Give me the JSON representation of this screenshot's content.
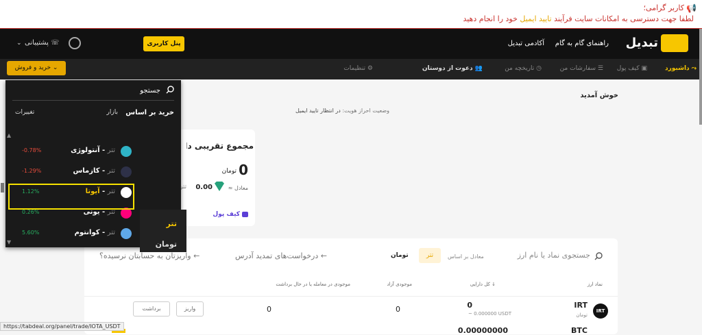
{
  "notice": {
    "greeting": "کاربر گرامی؛",
    "message_pre": "لطفا جهت دسترسی به امکانات سایت فرآیند ",
    "message_link": "تایید ایمیل",
    "message_post": " خود را انجام دهید"
  },
  "topbar": {
    "logo_text": "تبدیل",
    "guide": "راهنمای گام به گام",
    "academy": "آکادمی تبدیل",
    "panel_button": "پنل کاربری",
    "support": "پشتیبانی"
  },
  "nav": {
    "dashboard": "داشبورد",
    "wallet": "کیف پول",
    "orders": "سفارشات من",
    "history": "تاریخچه من",
    "invite": "دعوت از دوستان",
    "settings": "تنظیمات",
    "buy_sell": "خرید و فروش"
  },
  "welcome": "خوش آمدید",
  "kyc": {
    "label": "وضعیت احراز هویت:",
    "value": "در انتظار تایید ایمیل"
  },
  "dropdown": {
    "search_placeholder": "جستجو",
    "headers": {
      "sort": "خرید بر اساس",
      "market": "بازار",
      "changes": "تغییرات"
    },
    "coins": [
      {
        "name": "آنتولوژی",
        "quote": "تتر",
        "change": "-0.78%",
        "dir": "neg",
        "color": "#2fb3c6"
      },
      {
        "name": "کازماس",
        "quote": "تتر",
        "change": "-1.29%",
        "dir": "neg",
        "color": "#2e3148"
      },
      {
        "name": "آیوتا",
        "quote": "تتر",
        "change": "1.12%",
        "dir": "pos",
        "color": "#ffffff"
      },
      {
        "name": "یونی",
        "quote": "تتر",
        "change": "0.26%",
        "dir": "pos",
        "color": "#ff007a"
      },
      {
        "name": "کوانتوم",
        "quote": "تتر",
        "change": "5.60%",
        "dir": "pos",
        "color": "#5fa8e8"
      }
    ],
    "currencies": {
      "teter": "تتر",
      "toman": "تومان"
    }
  },
  "card": {
    "title": "مجموع تقریبی دارایی",
    "amount": "0",
    "unit": "تومان",
    "approx": "≈ معادل",
    "usdt_value": "0.00",
    "usdt_label": "تتر",
    "wallet_link": "کیف پول"
  },
  "assets": {
    "search_placeholder": "جستجوی نماد یا نام ارز",
    "equiv_label": "معادل بر اساس",
    "tag_teter": "تتر",
    "tag_toman": "تومان",
    "link_extend": "درخواست‌های تمدید آدرس",
    "link_deposit": "واریزتان به حسابتان نرسیده؟",
    "headers": {
      "symbol": "نماد ارز",
      "total": "کل دارایی",
      "free": "موجودی آزاد",
      "locked": "موجودی در معامله یا در حال برداشت"
    },
    "rows": [
      {
        "symbol": "IRT",
        "name": "تومان",
        "total": "0",
        "total_usdt": "~ 0.000000 USDT",
        "free": "0",
        "locked": "0",
        "deposit": "واریز",
        "withdraw": "برداشت"
      }
    ],
    "row2": {
      "symbol": "BTC",
      "total": "0.00000000"
    }
  },
  "status_url": "https://tabdeal.org/panel/trade/IOTA_USDT"
}
